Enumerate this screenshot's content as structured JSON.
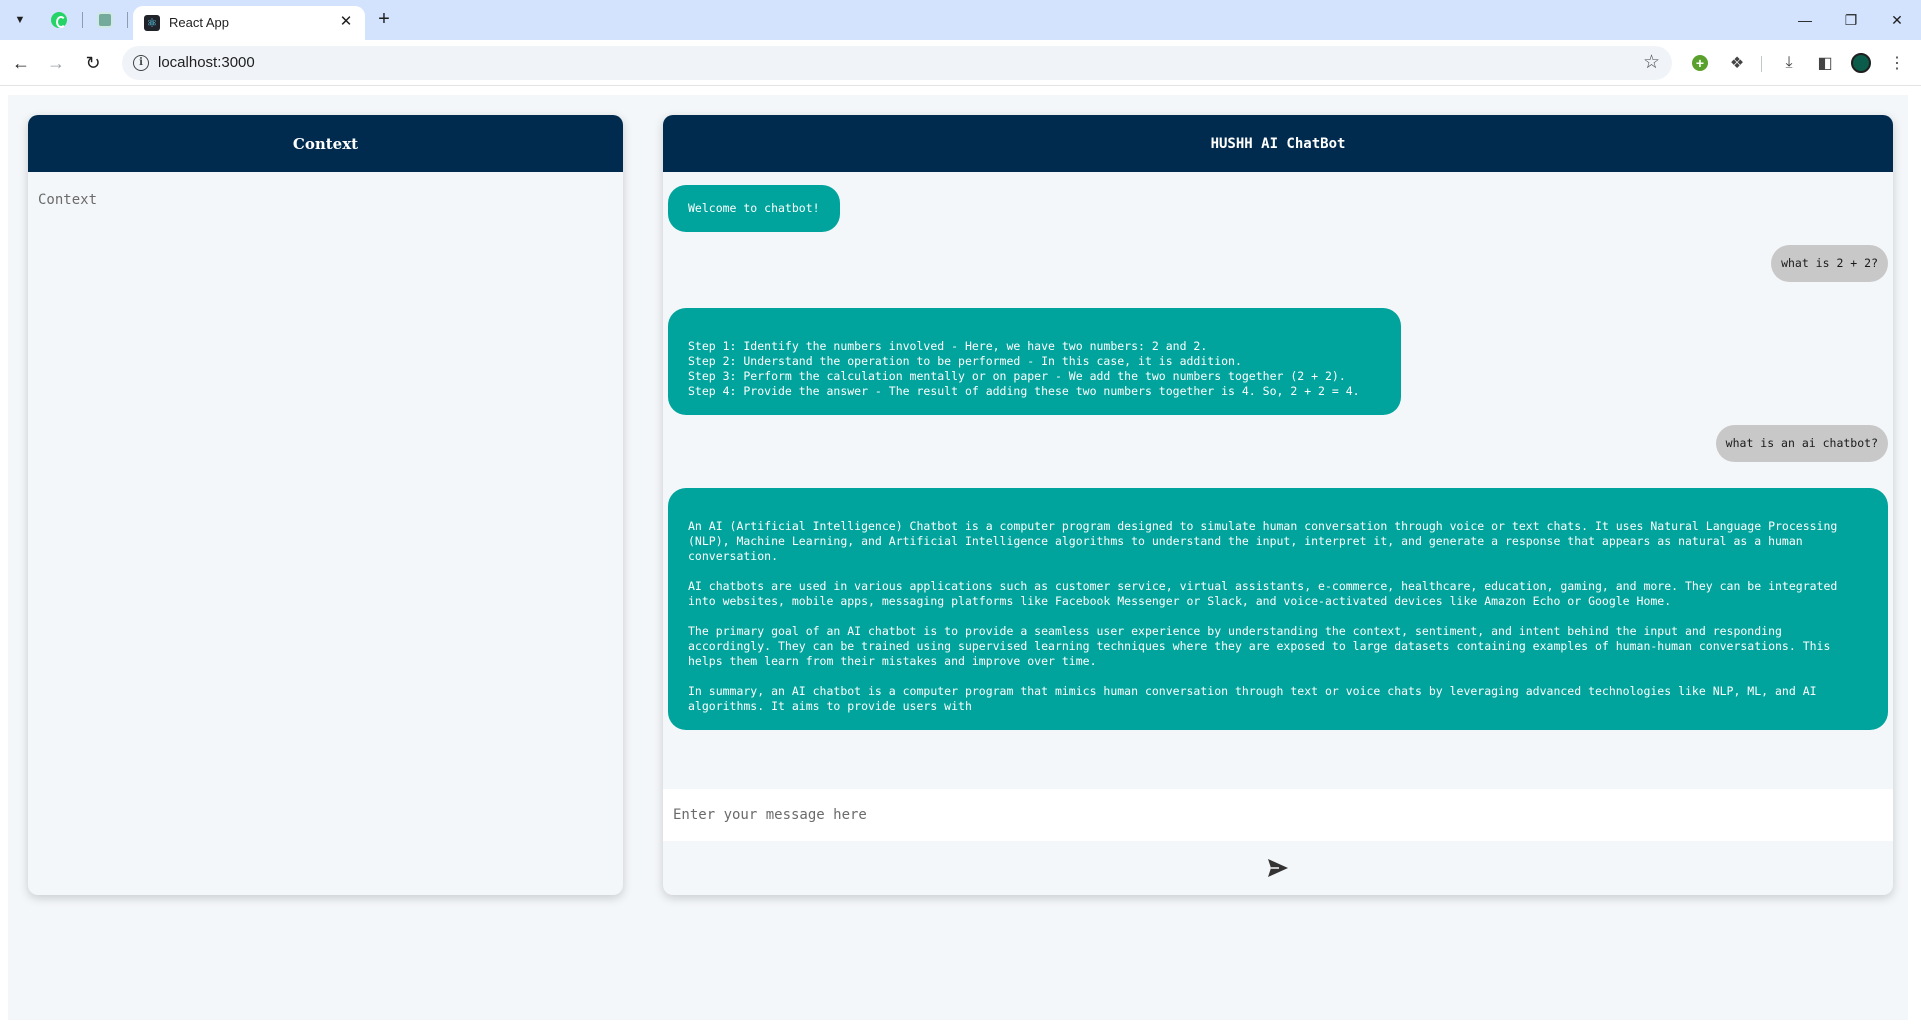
{
  "browser": {
    "active_tab_title": "React App",
    "url": "localhost:3000"
  },
  "context_panel": {
    "title": "Context",
    "placeholder": "Context"
  },
  "chat_panel": {
    "title": "HUSHH AI ChatBot",
    "input_placeholder": "Enter your message here",
    "messages": [
      {
        "role": "bot",
        "text": "Welcome to chatbot!"
      },
      {
        "role": "user",
        "text": "what is 2 + 2?"
      },
      {
        "role": "bot",
        "text": "\nStep 1: Identify the numbers involved - Here, we have two numbers: 2 and 2.\nStep 2: Understand the operation to be performed - In this case, it is addition.\nStep 3: Perform the calculation mentally or on paper - We add the two numbers together (2 + 2).\nStep 4: Provide the answer - The result of adding these two numbers together is 4. So, 2 + 2 = 4."
      },
      {
        "role": "user",
        "text": "what is an ai chatbot?"
      },
      {
        "role": "bot",
        "text": "\nAn AI (Artificial Intelligence) Chatbot is a computer program designed to simulate human conversation through voice or text chats. It uses Natural Language Processing (NLP), Machine Learning, and Artificial Intelligence algorithms to understand the input, interpret it, and generate a response that appears as natural as a human conversation.\n\nAI chatbots are used in various applications such as customer service, virtual assistants, e-commerce, healthcare, education, gaming, and more. They can be integrated into websites, mobile apps, messaging platforms like Facebook Messenger or Slack, and voice-activated devices like Amazon Echo or Google Home.\n\nThe primary goal of an AI chatbot is to provide a seamless user experience by understanding the context, sentiment, and intent behind the input and responding accordingly. They can be trained using supervised learning techniques where they are exposed to large datasets containing examples of human-human conversations. This helps them learn from their mistakes and improve over time.\n\nIn summary, an AI chatbot is a computer program that mimics human conversation through text or voice chats by leveraging advanced technologies like NLP, ML, and AI algorithms. It aims to provide users with"
      }
    ]
  },
  "colors": {
    "header_bg": "#002b4e",
    "bot_bubble": "#00a49c",
    "user_bubble": "#c8c8c8",
    "page_bg": "#f4f7fa"
  },
  "icons": {
    "send": "send-icon",
    "back": "back-arrow-icon",
    "forward": "forward-arrow-icon",
    "reload": "reload-icon",
    "bookmark": "star-icon"
  }
}
